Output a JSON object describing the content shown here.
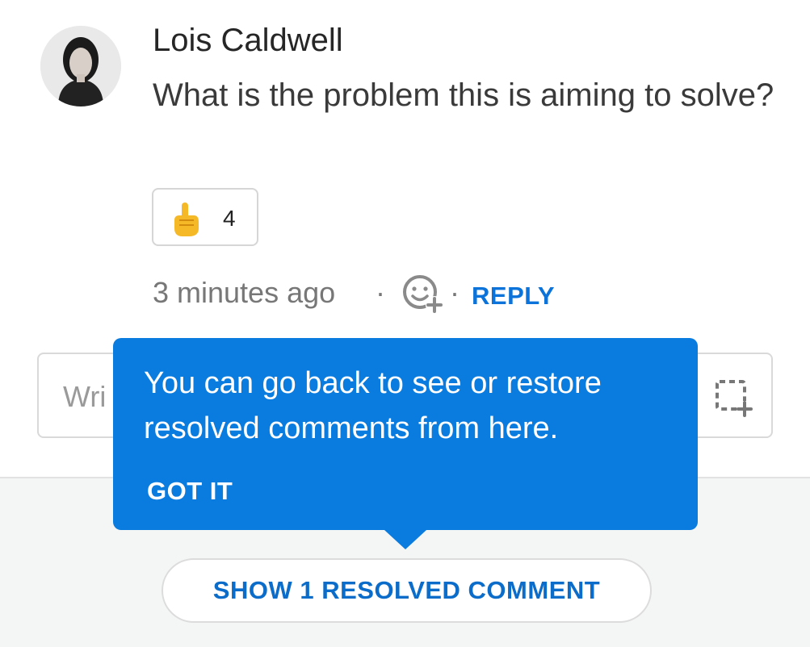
{
  "comment": {
    "author": "Lois Caldwell",
    "body": "What is the problem this is aiming to solve?",
    "reaction": {
      "emoji": "pointing-up-hand-icon",
      "count": "4"
    },
    "time": "3 minutes ago",
    "separator": "·",
    "reply_label": "REPLY"
  },
  "composer": {
    "placeholder_visible": "Wri"
  },
  "tooltip": {
    "text": "You can go back to see or restore resolved comments from here.",
    "action_label": "GOT IT"
  },
  "footer": {
    "show_resolved_label": "SHOW 1 RESOLVED COMMENT"
  },
  "colors": {
    "accent": "#0b73d9",
    "tooltip_bg": "#0a7ce0",
    "footer_bg": "#f4f5f5",
    "muted_text": "#777777"
  }
}
